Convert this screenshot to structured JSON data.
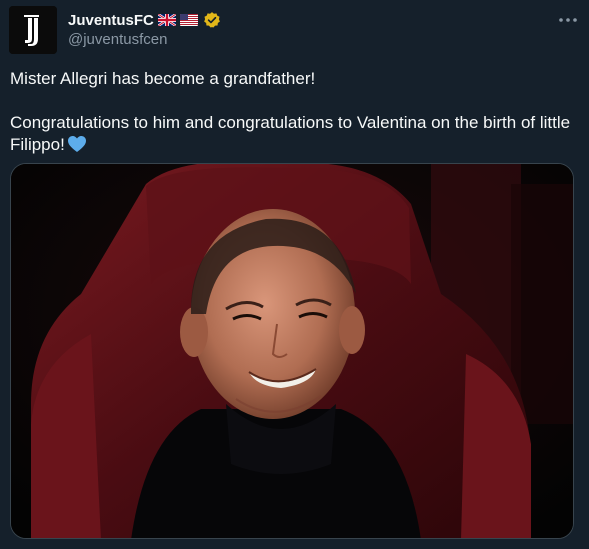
{
  "account": {
    "display_name": "JuventusFC",
    "handle": "@juventusfcen",
    "flags": [
      "uk-flag-icon",
      "us-flag-icon"
    ],
    "verified_icon": "verified-badge-icon",
    "avatar_icon": "juventus-logo-icon"
  },
  "tweet": {
    "line1": "Mister Allegri has become a grandfather!",
    "line2": "Congratulations to him and congratulations to Valentina on the birth of little Filippo!",
    "emoji_icon": "blue-heart-icon"
  },
  "colors": {
    "background": "#15202b",
    "text_primary": "#f7f9f9",
    "text_secondary": "#8b98a5",
    "verified_gold": "#e2b719",
    "heart_blue": "#5dadec",
    "border": "#38444d"
  }
}
